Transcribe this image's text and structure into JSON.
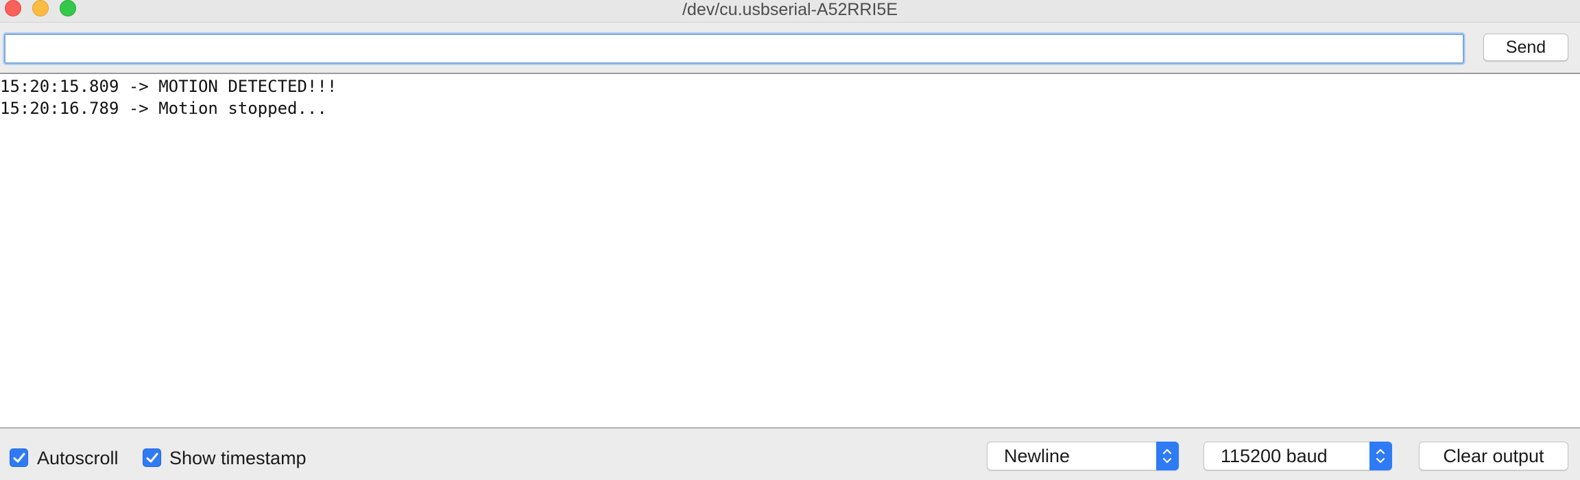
{
  "window": {
    "title": "/dev/cu.usbserial-A52RRI5E"
  },
  "send": {
    "input_value": "",
    "input_placeholder": "",
    "button_label": "Send"
  },
  "output": {
    "lines": [
      "15:20:15.809 -> MOTION DETECTED!!!",
      "15:20:16.789 -> Motion stopped..."
    ]
  },
  "footer": {
    "autoscroll": {
      "label": "Autoscroll",
      "checked": true
    },
    "show_timestamp": {
      "label": "Show timestamp",
      "checked": true
    },
    "line_ending": {
      "selected": "Newline"
    },
    "baud_rate": {
      "selected": "115200 baud"
    },
    "clear_label": "Clear output"
  },
  "colors": {
    "accent": "#2f7bf5",
    "titlebar": "#e7e7e7",
    "close": "#fc605b",
    "minimize": "#fdbc40",
    "maximize": "#34c84a"
  }
}
